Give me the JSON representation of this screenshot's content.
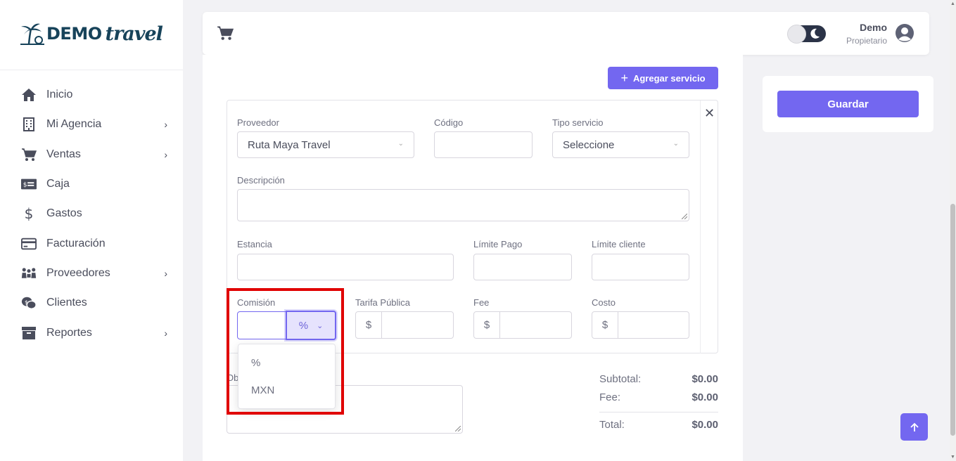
{
  "brand": {
    "demo": "DEMO",
    "travel": "travel"
  },
  "sidebar": {
    "items": [
      {
        "label": "Inicio",
        "icon": "home-icon",
        "has_children": false
      },
      {
        "label": "Mi Agencia",
        "icon": "building-icon",
        "has_children": true
      },
      {
        "label": "Ventas",
        "icon": "cart-icon",
        "has_children": true
      },
      {
        "label": "Caja",
        "icon": "cash-icon",
        "has_children": false
      },
      {
        "label": "Gastos",
        "icon": "dollar-icon",
        "has_children": false
      },
      {
        "label": "Facturación",
        "icon": "credit-card-icon",
        "has_children": false
      },
      {
        "label": "Proveedores",
        "icon": "people-icon",
        "has_children": true
      },
      {
        "label": "Clientes",
        "icon": "chat-dollar-icon",
        "has_children": false
      },
      {
        "label": "Reportes",
        "icon": "archive-icon",
        "has_children": true
      }
    ]
  },
  "header": {
    "user_name": "Demo",
    "user_role": "Propietario"
  },
  "form": {
    "add_service": "Agregar servicio",
    "proveedor": {
      "label": "Proveedor",
      "value": "Ruta Maya Travel"
    },
    "codigo": {
      "label": "Código",
      "value": ""
    },
    "tipo_servicio": {
      "label": "Tipo servicio",
      "value": "Seleccione"
    },
    "descripcion": {
      "label": "Descripción",
      "value": ""
    },
    "estancia": {
      "label": "Estancia",
      "value": ""
    },
    "limite_pago": {
      "label": "Límite Pago",
      "value": ""
    },
    "limite_cliente": {
      "label": "Límite cliente",
      "value": ""
    },
    "comision": {
      "label": "Comisión",
      "value": "",
      "unit": "%",
      "options": [
        "%",
        "MXN"
      ]
    },
    "tarifa_publica": {
      "label": "Tarifa Pública",
      "prefix": "$"
    },
    "fee": {
      "label": "Fee",
      "prefix": "$"
    },
    "costo": {
      "label": "Costo",
      "prefix": "$"
    },
    "observaciones_label": "Ob"
  },
  "totals": {
    "subtotal_label": "Subtotal:",
    "subtotal": "$0.00",
    "fee_label": "Fee:",
    "fee": "$0.00",
    "total_label": "Total:",
    "total": "$0.00"
  },
  "actions": {
    "save": "Guardar"
  },
  "colors": {
    "accent": "#7367f0",
    "highlight": "#e00000",
    "brand": "#17435a"
  }
}
